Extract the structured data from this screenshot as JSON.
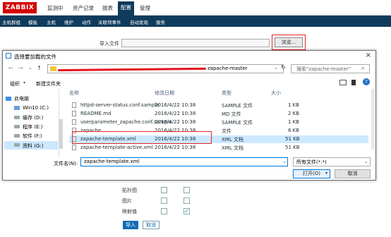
{
  "header": {
    "logo": "ZABBIX",
    "nav": [
      "监测中",
      "资产记录",
      "报表",
      "配置",
      "管理"
    ],
    "active_index": 3,
    "subnav": [
      "主机群组",
      "模板",
      "主机",
      "维护",
      "动作",
      "关联项事件",
      "自动发现",
      "服务"
    ]
  },
  "form": {
    "import_file_label": "导入文件",
    "browse_label": "浏览...",
    "options": [
      {
        "label": "拓扑图",
        "checks": [
          false,
          false
        ]
      },
      {
        "label": "图片",
        "checks": [
          false,
          false
        ]
      },
      {
        "label": "映射值",
        "checks": [
          false,
          true
        ]
      }
    ],
    "import_button": "导入",
    "cancel_button": "取消"
  },
  "dialog": {
    "title": "选择要加载的文件",
    "address_tail": "zapache-master",
    "search_placeholder": "搜索\"zapache-master\"",
    "organize": "组织",
    "new_folder": "新建文件夹",
    "nav_items": [
      "此电脑",
      "Win10 (C:)",
      "缓存 (D:)",
      "程序 (E:)",
      "软件 (F:)",
      "资料 (G:)"
    ],
    "nav_selected": 5,
    "columns": [
      "名称",
      "修改日期",
      "类型",
      "大小"
    ],
    "files": [
      {
        "name": "httpd-server-status.conf.sample",
        "date": "2016/4/22 10:38",
        "type": "SAMPLE 文件",
        "size": "1 KB"
      },
      {
        "name": "README.md",
        "date": "2016/4/22 10:38",
        "type": "MD 文件",
        "size": "2 KB"
      },
      {
        "name": "userparameter_zapache.conf.sample",
        "date": "2016/4/22 10:38",
        "type": "SAMPLE 文件",
        "size": "1 KB"
      },
      {
        "name": "zapache",
        "date": "2016/4/22 10:38",
        "type": "文件",
        "size": "6 KB"
      },
      {
        "name": "zapache-template.xml",
        "date": "2016/4/22 10:38",
        "type": "XML 文档",
        "size": "51 KB"
      },
      {
        "name": "zapache-template-active.xml",
        "date": "2016/4/22 10:38",
        "type": "XML 文档",
        "size": "51 KB"
      }
    ],
    "selected_file": 4,
    "filename_label": "文件名(N):",
    "filename_value": "zapache-template.xml",
    "filetype_value": "所有文件(*.*)",
    "open_button": "打开(O)",
    "cancel_button": "取消"
  },
  "colors": {
    "zabbix_red": "#d40000",
    "nav_blue": "#0f3b5c",
    "highlight_red": "#e0261f",
    "selection": "#cce8ff"
  }
}
